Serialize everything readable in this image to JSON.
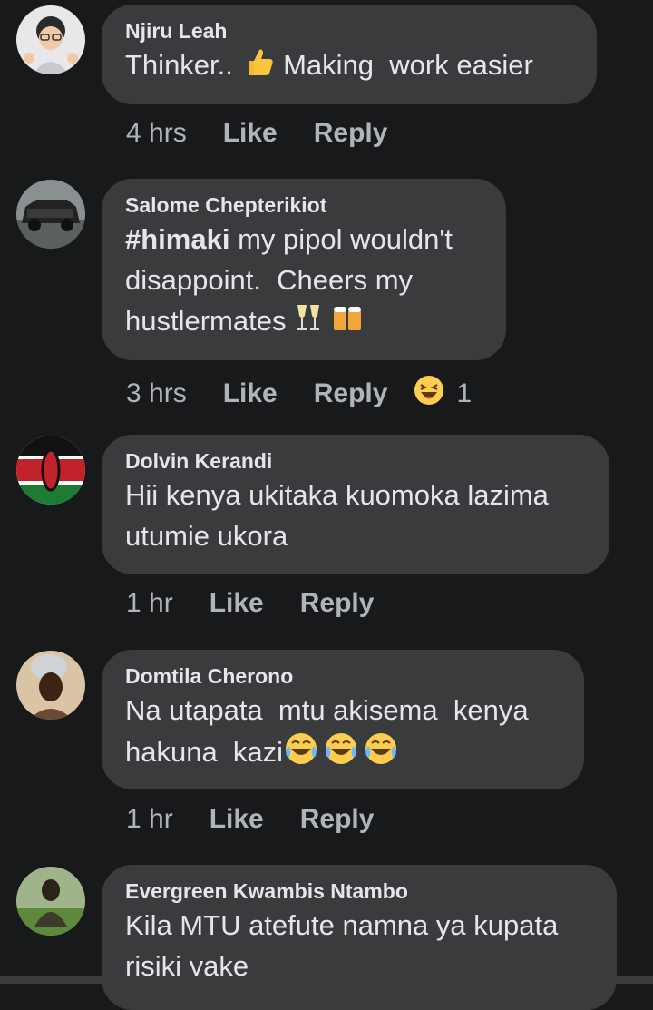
{
  "comments": [
    {
      "name": "Njiru Leah",
      "text_a": "Thinker.. ",
      "text_b": " Making  work easier",
      "time": "4 hrs",
      "like": "Like",
      "reply": "Reply"
    },
    {
      "name": "Salome Chepterikiot",
      "hashtag": "#himaki",
      "text_a": " my pipol wouldn't\ndisappoint.  Cheers my\nhustlermates ",
      "time": "3 hrs",
      "like": "Like",
      "reply": "Reply",
      "reaction_count": "1"
    },
    {
      "name": "Dolvin Kerandi",
      "text_a": "Hii kenya ukitaka kuomoka lazima\nutumie ukora",
      "time": "1 hr",
      "like": "Like",
      "reply": "Reply"
    },
    {
      "name": "Domtila Cherono",
      "text_a": "Na utapata  mtu akisema  kenya\nhakuna  kazi",
      "time": "1 hr",
      "like": "Like",
      "reply": "Reply"
    },
    {
      "name": "Evergreen Kwambis Ntambo",
      "text_a": "Kila MTU atefute namna ya kupata\nrisiki yake"
    }
  ],
  "icons": {
    "thumbs_up": "thumbs-up-emoji",
    "cheers": "champagne-and-beer-emoji",
    "haha": "haha-reaction-icon",
    "tears_of_joy": "tears-of-joy-emoji"
  },
  "colors": {
    "background": "#18191a",
    "bubble": "#3a3b3c",
    "text": "#e4e6eb",
    "meta": "#b0b3b8"
  }
}
